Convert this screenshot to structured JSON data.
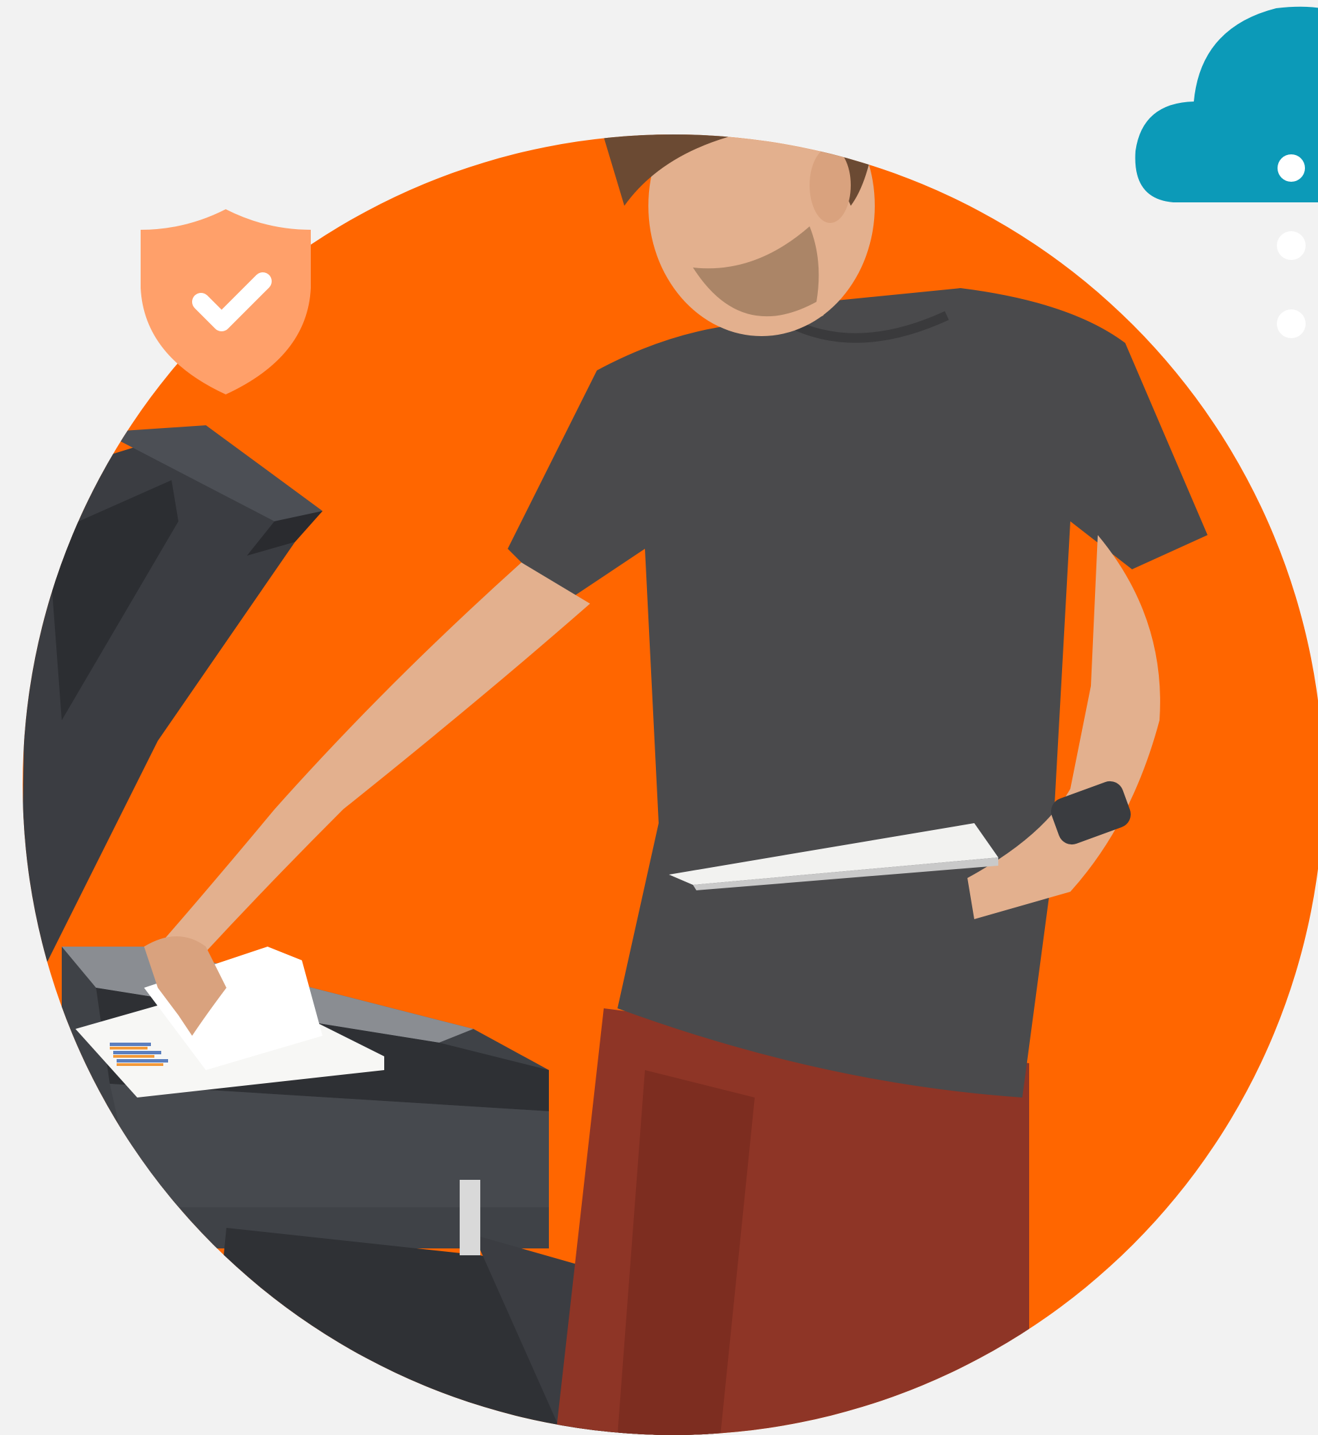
{
  "colors": {
    "background": "#f2f2f2",
    "accent_orange": "#ff6600",
    "shield_orange": "#ffa06a",
    "cloud_teal": "#0c9ab8",
    "tshirt": "#4a4a4c",
    "pants": "#8e3526",
    "skin": "#e3b08e",
    "hair": "#6b4a33",
    "printer_dark": "#3b3d42",
    "printer_mid": "#5a5d63",
    "paper": "#f7f7f5"
  },
  "icons": {
    "shield": "shield-check-icon",
    "cloud": "cloud-icon"
  }
}
